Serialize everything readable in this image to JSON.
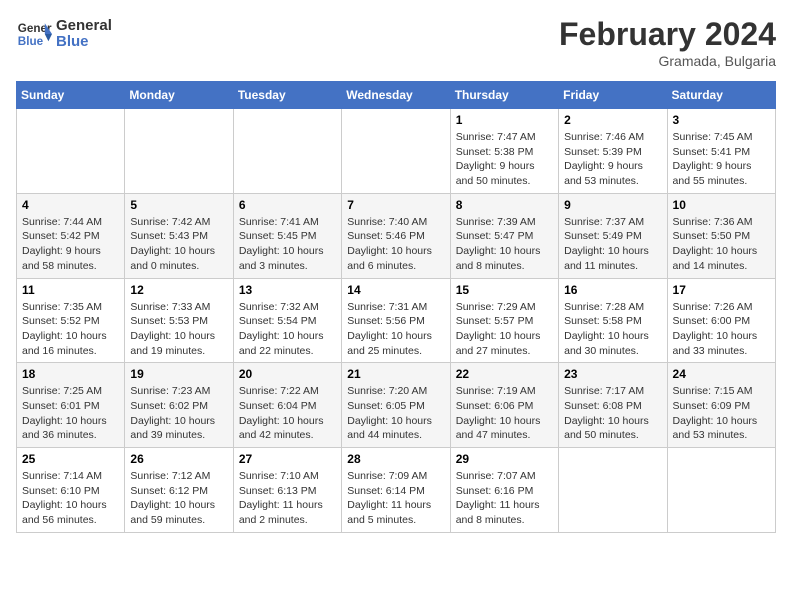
{
  "header": {
    "logo_line1": "General",
    "logo_line2": "Blue",
    "month_title": "February 2024",
    "subtitle": "Gramada, Bulgaria"
  },
  "days_of_week": [
    "Sunday",
    "Monday",
    "Tuesday",
    "Wednesday",
    "Thursday",
    "Friday",
    "Saturday"
  ],
  "weeks": [
    [
      {
        "day": "",
        "info": ""
      },
      {
        "day": "",
        "info": ""
      },
      {
        "day": "",
        "info": ""
      },
      {
        "day": "",
        "info": ""
      },
      {
        "day": "1",
        "info": "Sunrise: 7:47 AM\nSunset: 5:38 PM\nDaylight: 9 hours and 50 minutes."
      },
      {
        "day": "2",
        "info": "Sunrise: 7:46 AM\nSunset: 5:39 PM\nDaylight: 9 hours and 53 minutes."
      },
      {
        "day": "3",
        "info": "Sunrise: 7:45 AM\nSunset: 5:41 PM\nDaylight: 9 hours and 55 minutes."
      }
    ],
    [
      {
        "day": "4",
        "info": "Sunrise: 7:44 AM\nSunset: 5:42 PM\nDaylight: 9 hours and 58 minutes."
      },
      {
        "day": "5",
        "info": "Sunrise: 7:42 AM\nSunset: 5:43 PM\nDaylight: 10 hours and 0 minutes."
      },
      {
        "day": "6",
        "info": "Sunrise: 7:41 AM\nSunset: 5:45 PM\nDaylight: 10 hours and 3 minutes."
      },
      {
        "day": "7",
        "info": "Sunrise: 7:40 AM\nSunset: 5:46 PM\nDaylight: 10 hours and 6 minutes."
      },
      {
        "day": "8",
        "info": "Sunrise: 7:39 AM\nSunset: 5:47 PM\nDaylight: 10 hours and 8 minutes."
      },
      {
        "day": "9",
        "info": "Sunrise: 7:37 AM\nSunset: 5:49 PM\nDaylight: 10 hours and 11 minutes."
      },
      {
        "day": "10",
        "info": "Sunrise: 7:36 AM\nSunset: 5:50 PM\nDaylight: 10 hours and 14 minutes."
      }
    ],
    [
      {
        "day": "11",
        "info": "Sunrise: 7:35 AM\nSunset: 5:52 PM\nDaylight: 10 hours and 16 minutes."
      },
      {
        "day": "12",
        "info": "Sunrise: 7:33 AM\nSunset: 5:53 PM\nDaylight: 10 hours and 19 minutes."
      },
      {
        "day": "13",
        "info": "Sunrise: 7:32 AM\nSunset: 5:54 PM\nDaylight: 10 hours and 22 minutes."
      },
      {
        "day": "14",
        "info": "Sunrise: 7:31 AM\nSunset: 5:56 PM\nDaylight: 10 hours and 25 minutes."
      },
      {
        "day": "15",
        "info": "Sunrise: 7:29 AM\nSunset: 5:57 PM\nDaylight: 10 hours and 27 minutes."
      },
      {
        "day": "16",
        "info": "Sunrise: 7:28 AM\nSunset: 5:58 PM\nDaylight: 10 hours and 30 minutes."
      },
      {
        "day": "17",
        "info": "Sunrise: 7:26 AM\nSunset: 6:00 PM\nDaylight: 10 hours and 33 minutes."
      }
    ],
    [
      {
        "day": "18",
        "info": "Sunrise: 7:25 AM\nSunset: 6:01 PM\nDaylight: 10 hours and 36 minutes."
      },
      {
        "day": "19",
        "info": "Sunrise: 7:23 AM\nSunset: 6:02 PM\nDaylight: 10 hours and 39 minutes."
      },
      {
        "day": "20",
        "info": "Sunrise: 7:22 AM\nSunset: 6:04 PM\nDaylight: 10 hours and 42 minutes."
      },
      {
        "day": "21",
        "info": "Sunrise: 7:20 AM\nSunset: 6:05 PM\nDaylight: 10 hours and 44 minutes."
      },
      {
        "day": "22",
        "info": "Sunrise: 7:19 AM\nSunset: 6:06 PM\nDaylight: 10 hours and 47 minutes."
      },
      {
        "day": "23",
        "info": "Sunrise: 7:17 AM\nSunset: 6:08 PM\nDaylight: 10 hours and 50 minutes."
      },
      {
        "day": "24",
        "info": "Sunrise: 7:15 AM\nSunset: 6:09 PM\nDaylight: 10 hours and 53 minutes."
      }
    ],
    [
      {
        "day": "25",
        "info": "Sunrise: 7:14 AM\nSunset: 6:10 PM\nDaylight: 10 hours and 56 minutes."
      },
      {
        "day": "26",
        "info": "Sunrise: 7:12 AM\nSunset: 6:12 PM\nDaylight: 10 hours and 59 minutes."
      },
      {
        "day": "27",
        "info": "Sunrise: 7:10 AM\nSunset: 6:13 PM\nDaylight: 11 hours and 2 minutes."
      },
      {
        "day": "28",
        "info": "Sunrise: 7:09 AM\nSunset: 6:14 PM\nDaylight: 11 hours and 5 minutes."
      },
      {
        "day": "29",
        "info": "Sunrise: 7:07 AM\nSunset: 6:16 PM\nDaylight: 11 hours and 8 minutes."
      },
      {
        "day": "",
        "info": ""
      },
      {
        "day": "",
        "info": ""
      }
    ]
  ]
}
